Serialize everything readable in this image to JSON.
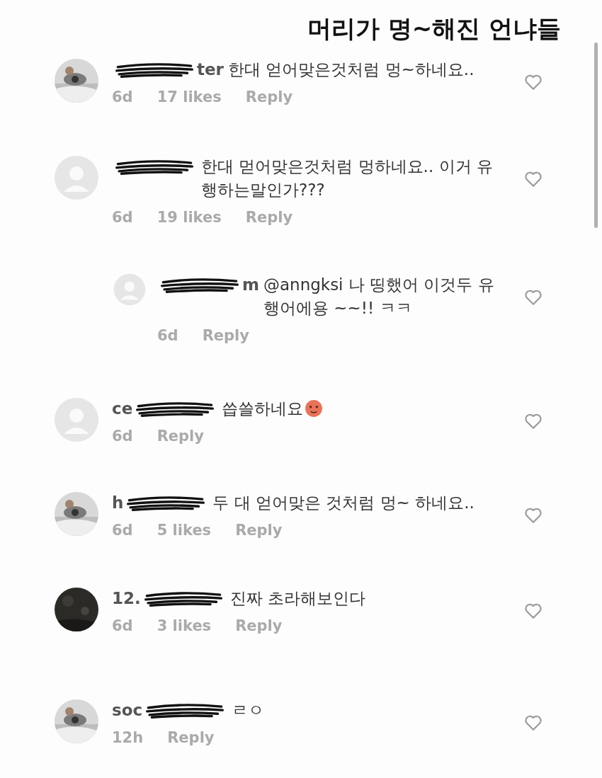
{
  "caption": "머리가 명~해진 언냐들",
  "comments": [
    {
      "username_after_scribble": true,
      "username": "ter",
      "text": "한대 얻어맞은것처럼 멍~하네요..",
      "time": "6d",
      "likes": "17 likes",
      "reply": "Reply",
      "emoji": false
    },
    {
      "avatar": {
        "kind": "placeholder"
      },
      "text": "한대 먿어맞은것처럼 멍하네요.. 이거 유행하는말인가???",
      "time": "6d",
      "likes": "19 likes",
      "reply": "Reply",
      "emoji": false,
      "children": [
        {
          "avatar": {
            "kind": "placeholder"
          },
          "username_after_scribble": true,
          "username": "m",
          "text": "@anngksi 나 띵했어 이것두 유행어에용 ~~!! ㅋㅋ",
          "time": "6d",
          "reply": "Reply",
          "emoji": false
        }
      ]
    },
    {
      "avatar": {
        "kind": "placeholder"
      },
      "username_after_scribble": false,
      "username": "ce",
      "text": "씁쓸하네요",
      "time": "6d",
      "reply": "Reply",
      "emoji": true
    },
    {
      "username_after_scribble": false,
      "username": "h",
      "text": "두 대 얻어맞은 것처럼 멍~ 하네요..",
      "time": "6d",
      "likes": "5 likes",
      "reply": "Reply",
      "emoji": false
    },
    {
      "avatar": {
        "kind": "dark"
      },
      "username_after_scribble": false,
      "username": "12.",
      "text": "진짜 초라해보인다",
      "time": "6d",
      "likes": "3 likes",
      "reply": "Reply",
      "emoji": false
    },
    {
      "username_after_scribble": false,
      "username": "soc",
      "text": "ㄹㅇ",
      "time": "12h",
      "reply": "Reply",
      "emoji": false
    }
  ]
}
